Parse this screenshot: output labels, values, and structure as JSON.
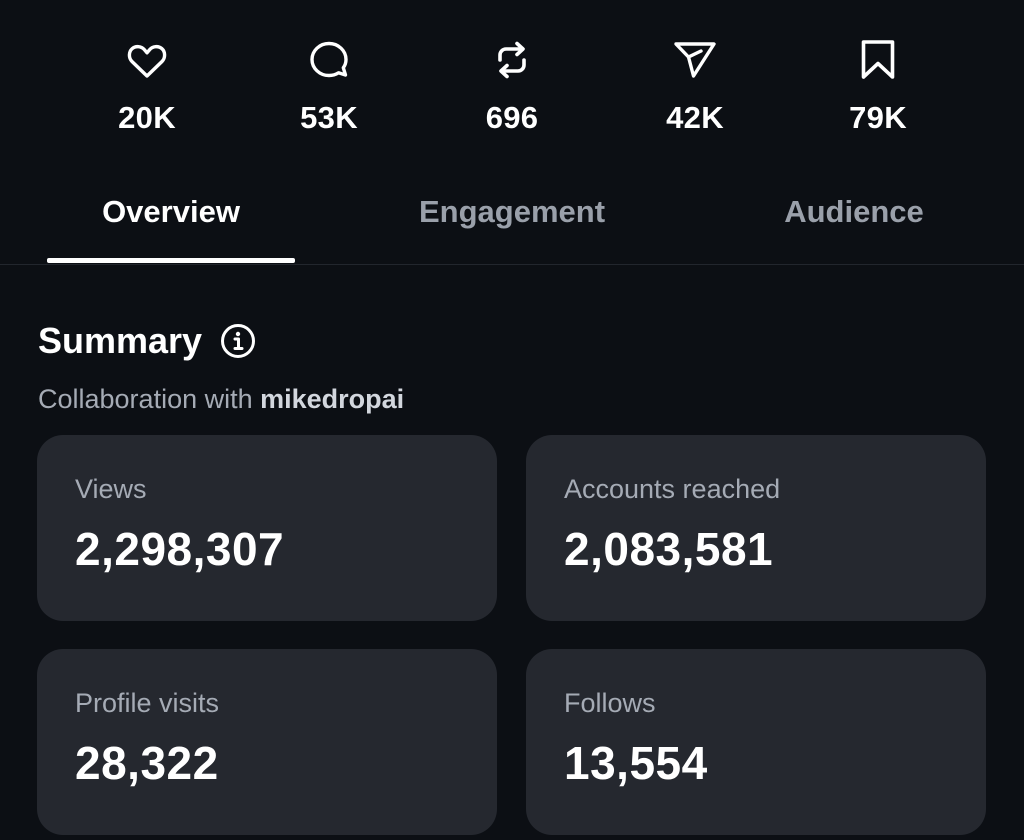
{
  "stats": [
    {
      "icon": "heart-icon",
      "value": "20K"
    },
    {
      "icon": "comment-icon",
      "value": "53K"
    },
    {
      "icon": "repost-icon",
      "value": "696"
    },
    {
      "icon": "share-icon",
      "value": "42K"
    },
    {
      "icon": "bookmark-icon",
      "value": "79K"
    }
  ],
  "tabs": [
    {
      "label": "Overview",
      "active": true
    },
    {
      "label": "Engagement",
      "active": false
    },
    {
      "label": "Audience",
      "active": false
    }
  ],
  "summary": {
    "title": "Summary",
    "info_icon": "info-icon",
    "collab_prefix": "Collaboration with",
    "collab_user": "mikedropai"
  },
  "cards": [
    {
      "label": "Views",
      "value": "2,298,307"
    },
    {
      "label": "Accounts reached",
      "value": "2,083,581"
    },
    {
      "label": "Profile visits",
      "value": "28,322"
    },
    {
      "label": "Follows",
      "value": "13,554"
    }
  ],
  "colors": {
    "background": "#0c0f14",
    "card": "#25282f",
    "text_primary": "#ffffff",
    "text_secondary": "#a5abb5",
    "tab_inactive": "#9aa0aa"
  }
}
